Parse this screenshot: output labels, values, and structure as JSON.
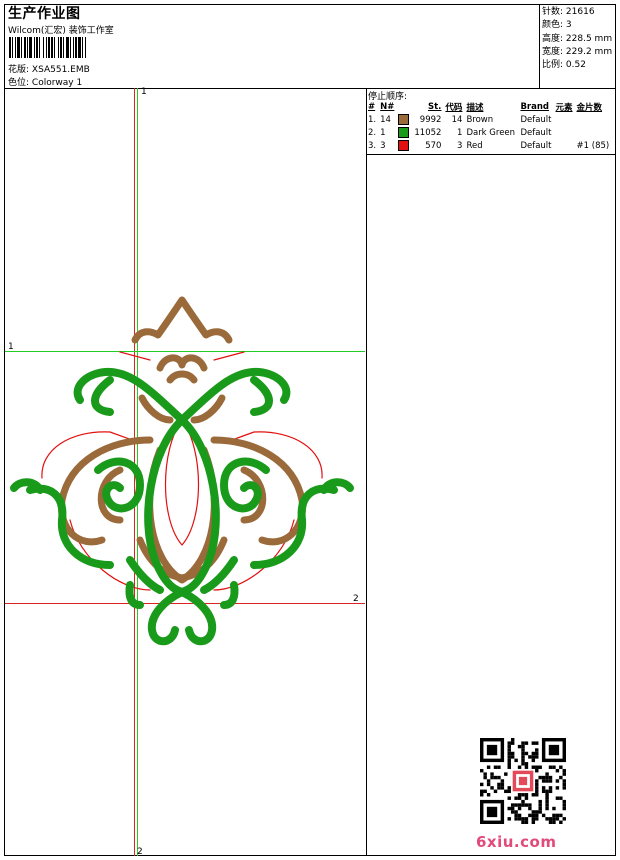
{
  "header": {
    "title": "生产作业图",
    "subtitle": "Wilcom(汇宏) 装饰工作室",
    "design_label": "花版:",
    "design_value": "XSA551.EMB",
    "color_label": "色位:",
    "color_value": "Colorway 1"
  },
  "stats": [
    {
      "label": "针数:",
      "value": "21616"
    },
    {
      "label": "颜色:",
      "value": "3"
    },
    {
      "label": "高度:",
      "value": "228.5 mm"
    },
    {
      "label": "宽度:",
      "value": "229.2 mm"
    },
    {
      "label": "比例:",
      "value": "0.52"
    }
  ],
  "stop_sequence": {
    "label": "停止顺序:",
    "columns": [
      "#",
      "N#",
      "St.",
      "代码",
      "描述",
      "Brand",
      "元素",
      "金片数"
    ],
    "rows": [
      {
        "idx": "1.",
        "n": "14",
        "color": "#9a6a3a",
        "st": "9992",
        "code": "14",
        "desc": "Brown",
        "brand": "Default",
        "elem": "",
        "seq": ""
      },
      {
        "idx": "2.",
        "n": "1",
        "color": "#1a9a1a",
        "st": "11052",
        "code": "1",
        "desc": "Dark Green",
        "brand": "Default",
        "elem": "",
        "seq": ""
      },
      {
        "idx": "3.",
        "n": "3",
        "color": "#e21010",
        "st": "570",
        "code": "3",
        "desc": "Red",
        "brand": "Default",
        "elem": "",
        "seq": "#1 (85)"
      }
    ]
  },
  "guides": {
    "v1": "1",
    "h1": "1",
    "h2": "2",
    "v2": "2"
  },
  "colors": {
    "brown": "#9a6a3a",
    "green": "#1a9a1a",
    "red": "#e21010",
    "guide_green": "#22cc22",
    "guide_red": "#dd2222"
  },
  "watermark": "6xiu.com"
}
